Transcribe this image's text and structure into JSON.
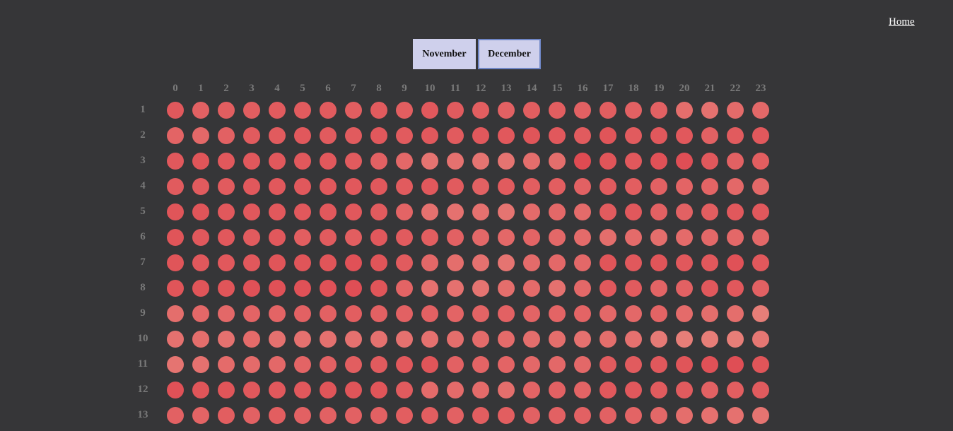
{
  "nav": {
    "home_label": "Home"
  },
  "month_tabs": [
    {
      "label": "November",
      "selected": false
    },
    {
      "label": "December",
      "selected": true
    }
  ],
  "grid": {
    "hours": [
      "0",
      "1",
      "2",
      "3",
      "4",
      "5",
      "6",
      "7",
      "8",
      "9",
      "10",
      "11",
      "12",
      "13",
      "14",
      "15",
      "16",
      "17",
      "18",
      "19",
      "20",
      "21",
      "22",
      "23"
    ],
    "days": [
      "1",
      "2",
      "3",
      "4",
      "5",
      "6",
      "7",
      "8",
      "9",
      "10",
      "11",
      "12",
      "13"
    ],
    "colors": {
      "low": "#e8877f",
      "high": "#de4850"
    },
    "intensity": [
      [
        0.75,
        0.6,
        0.65,
        0.65,
        0.7,
        0.7,
        0.7,
        0.65,
        0.7,
        0.65,
        0.75,
        0.7,
        0.65,
        0.6,
        0.65,
        0.65,
        0.6,
        0.65,
        0.6,
        0.6,
        0.4,
        0.35,
        0.45,
        0.5
      ],
      [
        0.55,
        0.5,
        0.6,
        0.7,
        0.7,
        0.75,
        0.7,
        0.7,
        0.75,
        0.7,
        0.75,
        0.7,
        0.75,
        0.75,
        0.8,
        0.75,
        0.7,
        0.8,
        0.7,
        0.75,
        0.75,
        0.6,
        0.7,
        0.75
      ],
      [
        0.75,
        0.8,
        0.75,
        0.75,
        0.75,
        0.75,
        0.75,
        0.7,
        0.6,
        0.5,
        0.3,
        0.35,
        0.3,
        0.3,
        0.4,
        0.4,
        0.95,
        0.8,
        0.75,
        0.85,
        0.9,
        0.75,
        0.6,
        0.65
      ],
      [
        0.7,
        0.7,
        0.7,
        0.75,
        0.75,
        0.75,
        0.75,
        0.75,
        0.75,
        0.7,
        0.75,
        0.7,
        0.6,
        0.7,
        0.65,
        0.65,
        0.6,
        0.7,
        0.65,
        0.6,
        0.55,
        0.55,
        0.5,
        0.5
      ],
      [
        0.8,
        0.8,
        0.75,
        0.75,
        0.75,
        0.75,
        0.75,
        0.75,
        0.7,
        0.55,
        0.35,
        0.35,
        0.35,
        0.3,
        0.45,
        0.5,
        0.45,
        0.7,
        0.75,
        0.6,
        0.6,
        0.65,
        0.75,
        0.75
      ],
      [
        0.8,
        0.75,
        0.75,
        0.7,
        0.75,
        0.65,
        0.7,
        0.65,
        0.75,
        0.7,
        0.65,
        0.6,
        0.5,
        0.5,
        0.55,
        0.5,
        0.45,
        0.4,
        0.45,
        0.4,
        0.45,
        0.5,
        0.5,
        0.5
      ],
      [
        0.8,
        0.75,
        0.75,
        0.75,
        0.8,
        0.8,
        0.8,
        0.85,
        0.8,
        0.7,
        0.5,
        0.4,
        0.35,
        0.3,
        0.45,
        0.5,
        0.5,
        0.8,
        0.75,
        0.8,
        0.75,
        0.75,
        0.85,
        0.75
      ],
      [
        0.8,
        0.8,
        0.8,
        0.85,
        0.85,
        0.85,
        0.85,
        0.9,
        0.8,
        0.55,
        0.35,
        0.35,
        0.3,
        0.4,
        0.45,
        0.35,
        0.5,
        0.75,
        0.7,
        0.55,
        0.6,
        0.75,
        0.75,
        0.6
      ],
      [
        0.4,
        0.5,
        0.5,
        0.55,
        0.55,
        0.6,
        0.6,
        0.65,
        0.6,
        0.6,
        0.6,
        0.55,
        0.55,
        0.6,
        0.55,
        0.55,
        0.55,
        0.5,
        0.5,
        0.55,
        0.45,
        0.4,
        0.4,
        0.15
      ],
      [
        0.35,
        0.4,
        0.35,
        0.45,
        0.35,
        0.35,
        0.35,
        0.35,
        0.35,
        0.35,
        0.35,
        0.4,
        0.45,
        0.45,
        0.4,
        0.4,
        0.35,
        0.4,
        0.35,
        0.2,
        0.15,
        0.15,
        0.15,
        0.25
      ],
      [
        0.3,
        0.35,
        0.45,
        0.45,
        0.5,
        0.55,
        0.6,
        0.65,
        0.7,
        0.75,
        0.8,
        0.6,
        0.55,
        0.55,
        0.5,
        0.5,
        0.5,
        0.7,
        0.7,
        0.75,
        0.8,
        0.85,
        0.9,
        0.8
      ],
      [
        0.85,
        0.8,
        0.8,
        0.75,
        0.75,
        0.75,
        0.8,
        0.8,
        0.8,
        0.7,
        0.45,
        0.45,
        0.45,
        0.4,
        0.55,
        0.6,
        0.55,
        0.75,
        0.75,
        0.7,
        0.7,
        0.6,
        0.65,
        0.7
      ],
      [
        0.6,
        0.55,
        0.65,
        0.6,
        0.65,
        0.6,
        0.6,
        0.6,
        0.6,
        0.65,
        0.65,
        0.6,
        0.65,
        0.65,
        0.6,
        0.6,
        0.6,
        0.6,
        0.55,
        0.5,
        0.4,
        0.35,
        0.35,
        0.3
      ]
    ]
  }
}
